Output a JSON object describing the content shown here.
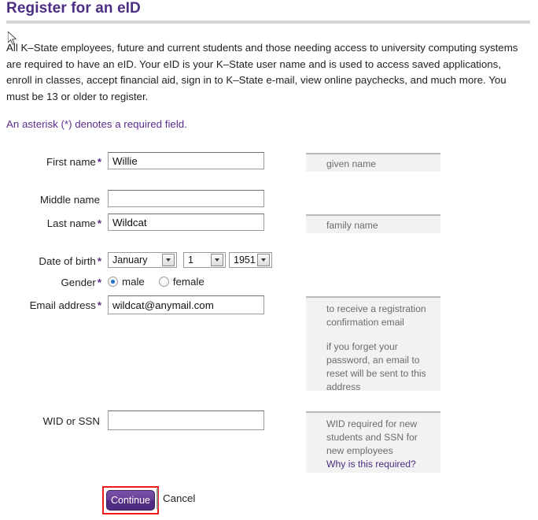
{
  "page": {
    "title": "Register for an eID",
    "intro": "All K–State employees, future and current students and those needing access to university computing systems are required to have an eID. Your eID is your K–State user name and is used to access saved applications, enroll in classes, accept financial aid, sign in to K–State e-mail, view online paychecks, and much more. You must be 13 or older to register.",
    "required_note": "An asterisk (*) denotes a required field.",
    "accent_purple": "#4b2d83",
    "link_purple": "#5b2e8c",
    "highlight_red": "#ee1c1c"
  },
  "form": {
    "first_name": {
      "label": "First name",
      "required_mark": "*",
      "value": "Willie",
      "placeholder": "",
      "hint": "given name"
    },
    "middle_name": {
      "label": "Middle name",
      "required_mark": "",
      "value": "",
      "placeholder": ""
    },
    "last_name": {
      "label": "Last name",
      "required_mark": "*",
      "value": "Wildcat",
      "placeholder": "",
      "hint": "family name"
    },
    "date_of_birth": {
      "label": "Date of birth",
      "required_mark": "*",
      "month": "January",
      "day": "1",
      "year": "1951"
    },
    "gender": {
      "label": "Gender",
      "required_mark": "*",
      "options": [
        "male",
        "female"
      ],
      "selected": "male"
    },
    "email": {
      "label": "Email address",
      "required_mark": "*",
      "value": "wildcat@anymail.com",
      "placeholder": "",
      "hint_line_1": "to receive a registration confirmation email",
      "hint_line_2": "if you forget your password, an email to reset will be sent to this address"
    },
    "wid_ssn": {
      "label": "WID or SSN",
      "required_mark": "",
      "value": "",
      "placeholder": "",
      "hint": "WID required for new students and SSN for new employees",
      "hint_link": "Why is this required?"
    }
  },
  "actions": {
    "continue_label": "Continue",
    "cancel_label": "Cancel"
  },
  "icons": {
    "mouse_cursor": "mouse-pointer-icon",
    "dropdown_arrow": "chevron-down-icon"
  }
}
